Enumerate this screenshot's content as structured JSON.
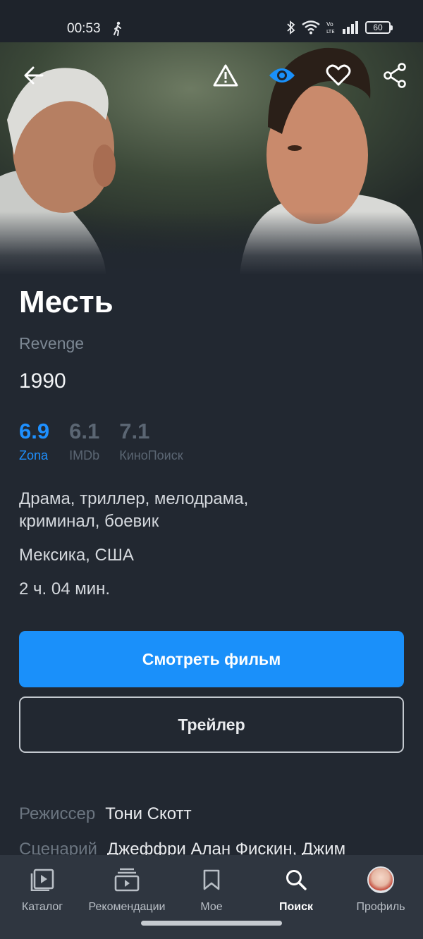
{
  "status_bar": {
    "time": "00:53",
    "battery": "60",
    "icons": [
      "walking-icon",
      "bluetooth-icon",
      "wifi-icon",
      "volte-icon",
      "signal-icon",
      "battery-icon"
    ]
  },
  "hero": {
    "actions": [
      "back-arrow-icon",
      "report-warning-icon",
      "watched-eye-icon",
      "favorite-heart-icon",
      "share-icon"
    ]
  },
  "movie": {
    "title": "Месть",
    "original_title": "Revenge",
    "year": "1990",
    "ratings": [
      {
        "value": "6.9",
        "source": "Zona"
      },
      {
        "value": "6.1",
        "source": "IMDb"
      },
      {
        "value": "7.1",
        "source": "КиноПоиск"
      }
    ],
    "genres": "Драма, триллер, мелодрама, криминал, боевик",
    "countries": "Мексика, США",
    "duration": "2 ч. 04 мин."
  },
  "buttons": {
    "watch": "Смотреть фильм",
    "trailer": "Трейлер"
  },
  "credits": [
    {
      "label": "Режиссер",
      "value": "Тони Скотт"
    },
    {
      "label": "Сценарий",
      "value": "Джеффри Алан Фискин, Джим"
    }
  ],
  "bottom_nav": [
    {
      "label": "Каталог",
      "icon": "catalog-icon"
    },
    {
      "label": "Рекомендации",
      "icon": "recommendations-icon"
    },
    {
      "label": "Мое",
      "icon": "bookmark-icon"
    },
    {
      "label": "Поиск",
      "icon": "search-icon",
      "active": true
    },
    {
      "label": "Профиль",
      "icon": "avatar"
    }
  ],
  "colors": {
    "accent": "#1a90fa",
    "background": "#222831",
    "nav_background": "#2f3640",
    "muted_text": "#6b7580"
  }
}
